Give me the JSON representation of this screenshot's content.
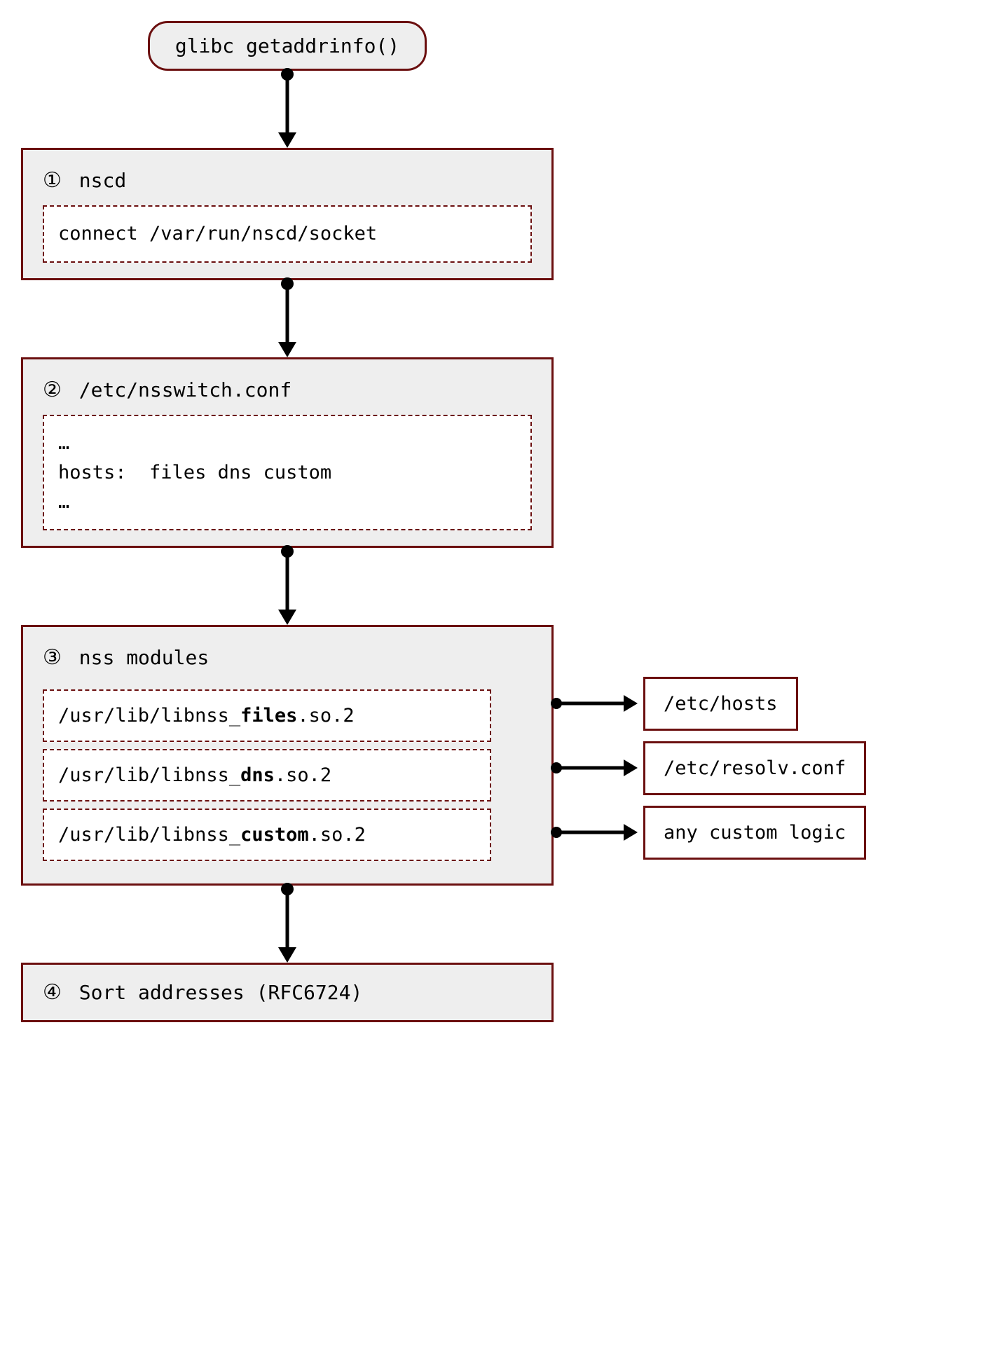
{
  "top": {
    "label_a": "glibc",
    "label_b": "getaddrinfo()"
  },
  "step1": {
    "num": "①",
    "title": "nscd",
    "body": "connect /var/run/nscd/socket"
  },
  "step2": {
    "num": "②",
    "title": "/etc/nsswitch.conf",
    "body": "…\nhosts:  files dns custom\n…"
  },
  "step3": {
    "num": "③",
    "title": "nss modules",
    "modules": [
      {
        "pre": "/usr/lib/libnss_",
        "key": "files",
        "post": ".so.2",
        "target": "/etc/hosts"
      },
      {
        "pre": "/usr/lib/libnss_",
        "key": "dns",
        "post": ".so.2",
        "target": "/etc/resolv.conf"
      },
      {
        "pre": "/usr/lib/libnss_",
        "key": "custom",
        "post": ".so.2",
        "target": "any custom logic"
      }
    ]
  },
  "step4": {
    "num": "④",
    "title": "Sort addresses (RFC6724)"
  },
  "colors": {
    "border": "#6b0f0f",
    "fill": "#eeeeee"
  }
}
